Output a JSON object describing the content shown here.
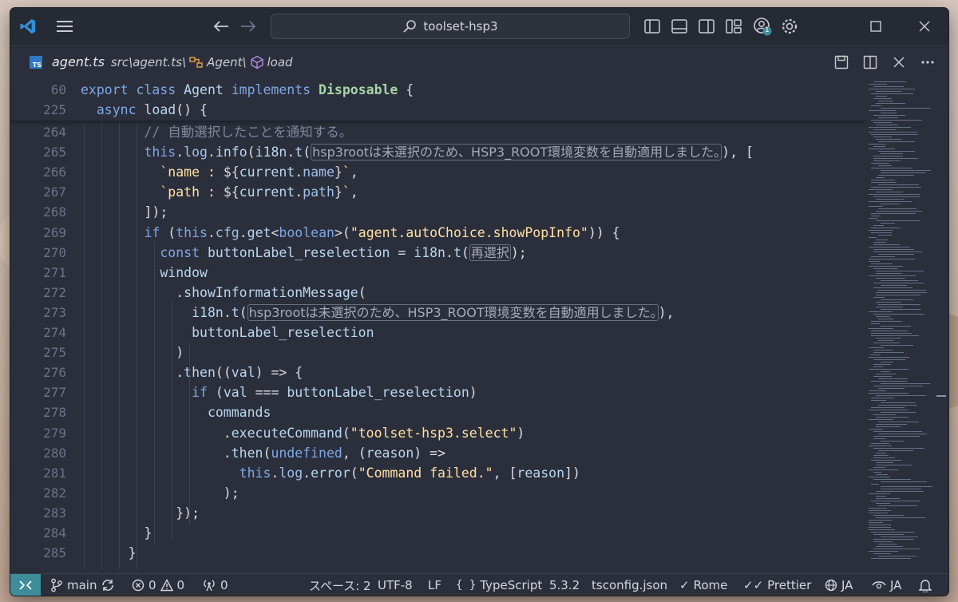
{
  "titlebar": {
    "search_text": "toolset-hsp3",
    "account_badge": "1"
  },
  "tab": {
    "file_icon": "TS",
    "file_name": "agent.ts",
    "path": "src\\agent.ts\\",
    "crumb_class": "Agent\\",
    "crumb_method": "load"
  },
  "editor": {
    "sticky": [
      {
        "line": "60",
        "tokens": [
          [
            "kw",
            "export class "
          ],
          [
            "fn",
            "Agent "
          ],
          [
            "kw",
            "implements "
          ],
          [
            "cls",
            "Disposable"
          ],
          [
            "punc",
            " {"
          ]
        ]
      },
      {
        "line": "225",
        "tokens": [
          [
            "kw",
            "  async "
          ],
          [
            "fn",
            "load"
          ],
          [
            "punc",
            "() {"
          ]
        ]
      }
    ],
    "lines": [
      {
        "line": "264",
        "tokens": [
          [
            "cmt",
            "        // 自動選択したことを通知する。"
          ]
        ]
      },
      {
        "line": "265",
        "tokens": [
          [
            "kw",
            "        this"
          ],
          [
            "punc",
            "."
          ],
          [
            "prop",
            "log"
          ],
          [
            "punc",
            "."
          ],
          [
            "fn",
            "info"
          ],
          [
            "punc",
            "("
          ],
          [
            "fn",
            "i18n"
          ],
          [
            "punc",
            "."
          ],
          [
            "fn",
            "t"
          ],
          [
            "punc",
            "("
          ],
          [
            "hint",
            "hsp3rootは未選択のため、HSP3_ROOT環境変数を自動適用しました。"
          ],
          [
            "punc",
            "), ["
          ]
        ]
      },
      {
        "line": "266",
        "tokens": [
          [
            "str",
            "          `name : "
          ],
          [
            "punc",
            "${"
          ],
          [
            "fn",
            "current"
          ],
          [
            "punc",
            "."
          ],
          [
            "prop",
            "name"
          ],
          [
            "punc",
            "}"
          ],
          [
            "str",
            "`"
          ],
          [
            "punc",
            ","
          ]
        ]
      },
      {
        "line": "267",
        "tokens": [
          [
            "str",
            "          `path : "
          ],
          [
            "punc",
            "${"
          ],
          [
            "fn",
            "current"
          ],
          [
            "punc",
            "."
          ],
          [
            "prop",
            "path"
          ],
          [
            "punc",
            "}"
          ],
          [
            "str",
            "`"
          ],
          [
            "punc",
            ","
          ]
        ]
      },
      {
        "line": "268",
        "tokens": [
          [
            "punc",
            "        ]);"
          ]
        ]
      },
      {
        "line": "269",
        "tokens": [
          [
            "kw",
            "        if "
          ],
          [
            "punc",
            "("
          ],
          [
            "kw",
            "this"
          ],
          [
            "punc",
            "."
          ],
          [
            "prop",
            "cfg"
          ],
          [
            "punc",
            "."
          ],
          [
            "fn",
            "get"
          ],
          [
            "punc",
            "<"
          ],
          [
            "kw",
            "boolean"
          ],
          [
            "punc",
            ">("
          ],
          [
            "str",
            "\"agent.autoChoice.showPopInfo\""
          ],
          [
            "punc",
            ")) {"
          ]
        ]
      },
      {
        "line": "270",
        "tokens": [
          [
            "kw",
            "          const "
          ],
          [
            "fn",
            "buttonLabel_reselection"
          ],
          [
            "punc",
            " = "
          ],
          [
            "fn",
            "i18n"
          ],
          [
            "punc",
            "."
          ],
          [
            "fn",
            "t"
          ],
          [
            "punc",
            "("
          ],
          [
            "hint",
            "再選択"
          ],
          [
            "punc",
            ");"
          ]
        ]
      },
      {
        "line": "271",
        "tokens": [
          [
            "fn",
            "          window"
          ]
        ]
      },
      {
        "line": "272",
        "tokens": [
          [
            "punc",
            "            ."
          ],
          [
            "fn",
            "showInformationMessage"
          ],
          [
            "punc",
            "("
          ]
        ]
      },
      {
        "line": "273",
        "tokens": [
          [
            "fn",
            "              i18n"
          ],
          [
            "punc",
            "."
          ],
          [
            "fn",
            "t"
          ],
          [
            "punc",
            "("
          ],
          [
            "hint",
            "hsp3rootは未選択のため、HSP3_ROOT環境変数を自動適用しました。"
          ],
          [
            "punc",
            "),"
          ]
        ]
      },
      {
        "line": "274",
        "tokens": [
          [
            "fn",
            "              buttonLabel_reselection"
          ]
        ]
      },
      {
        "line": "275",
        "tokens": [
          [
            "punc",
            "            )"
          ]
        ]
      },
      {
        "line": "276",
        "tokens": [
          [
            "punc",
            "            ."
          ],
          [
            "fn",
            "then"
          ],
          [
            "punc",
            "(("
          ],
          [
            "fn",
            "val"
          ],
          [
            "punc",
            ") => {"
          ]
        ]
      },
      {
        "line": "277",
        "tokens": [
          [
            "kw",
            "              if "
          ],
          [
            "punc",
            "("
          ],
          [
            "fn",
            "val"
          ],
          [
            "punc",
            " === "
          ],
          [
            "fn",
            "buttonLabel_reselection"
          ],
          [
            "punc",
            ")"
          ]
        ]
      },
      {
        "line": "278",
        "tokens": [
          [
            "fn",
            "                commands"
          ]
        ]
      },
      {
        "line": "279",
        "tokens": [
          [
            "punc",
            "                  ."
          ],
          [
            "fn",
            "executeCommand"
          ],
          [
            "punc",
            "("
          ],
          [
            "str",
            "\"toolset-hsp3.select\""
          ],
          [
            "punc",
            ")"
          ]
        ]
      },
      {
        "line": "280",
        "tokens": [
          [
            "punc",
            "                  ."
          ],
          [
            "fn",
            "then"
          ],
          [
            "punc",
            "("
          ],
          [
            "kw",
            "undefined"
          ],
          [
            "punc",
            ", ("
          ],
          [
            "fn",
            "reason"
          ],
          [
            "punc",
            ") =>"
          ]
        ]
      },
      {
        "line": "281",
        "tokens": [
          [
            "kw",
            "                    this"
          ],
          [
            "punc",
            "."
          ],
          [
            "prop",
            "log"
          ],
          [
            "punc",
            "."
          ],
          [
            "fn",
            "error"
          ],
          [
            "punc",
            "("
          ],
          [
            "str",
            "\"Command failed.\""
          ],
          [
            "punc",
            ", ["
          ],
          [
            "fn",
            "reason"
          ],
          [
            "punc",
            "])"
          ]
        ]
      },
      {
        "line": "282",
        "tokens": [
          [
            "punc",
            "                  );"
          ]
        ]
      },
      {
        "line": "283",
        "tokens": [
          [
            "punc",
            "            });"
          ]
        ]
      },
      {
        "line": "284",
        "tokens": [
          [
            "punc",
            "        }"
          ]
        ]
      },
      {
        "line": "285",
        "tokens": [
          [
            "punc",
            "      }"
          ]
        ]
      }
    ]
  },
  "statusbar": {
    "branch": "main",
    "errors": "0",
    "warnings": "0",
    "ports": "0",
    "indent": "スペース: 2",
    "encoding": "UTF-8",
    "eol": "LF",
    "language": "TypeScript",
    "ts_version": "5.3.2",
    "tsconfig": "tsconfig.json",
    "formatter1": "Rome",
    "formatter2": "Prettier",
    "lang1": "JA",
    "lang2": "JA"
  },
  "colors": {
    "accent": "#3f8d9a",
    "vscode_blue": "#2f8fd8",
    "ts_blue": "#3178c6"
  }
}
